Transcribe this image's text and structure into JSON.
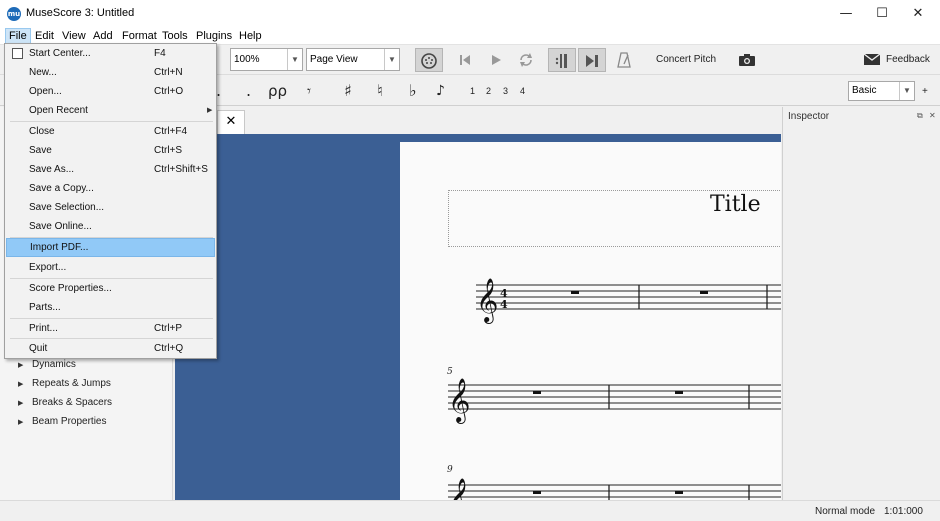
{
  "window": {
    "title": "MuseScore 3: Untitled",
    "app_icon": "mu",
    "minimize": "—",
    "maximize": "☐",
    "close": "✕"
  },
  "menubar": [
    "File",
    "Edit",
    "View",
    "Add",
    "Format",
    "Tools",
    "Plugins",
    "Help"
  ],
  "toolbar": {
    "zoom": "100%",
    "view_mode": "Page View",
    "concert_pitch": "Concert Pitch",
    "feedback": "Feedback",
    "workspace": "Basic",
    "workspace_add": "+",
    "voices": [
      "1",
      "2",
      "3",
      "4"
    ],
    "accidentals": [
      "♯",
      "♮",
      "♭"
    ]
  },
  "file_menu": {
    "start_center": {
      "label": "Start Center...",
      "shortcut": "F4"
    },
    "new": {
      "label": "New...",
      "shortcut": "Ctrl+N"
    },
    "open": {
      "label": "Open...",
      "shortcut": "Ctrl+O"
    },
    "open_recent": {
      "label": "Open Recent",
      "submenu_arrow": "▶"
    },
    "close": {
      "label": "Close",
      "shortcut": "Ctrl+F4"
    },
    "save": {
      "label": "Save",
      "shortcut": "Ctrl+S"
    },
    "save_as": {
      "label": "Save As...",
      "shortcut": "Ctrl+Shift+S"
    },
    "save_copy": {
      "label": "Save a Copy..."
    },
    "save_selection": {
      "label": "Save Selection..."
    },
    "save_online": {
      "label": "Save Online..."
    },
    "import_pdf": {
      "label": "Import PDF..."
    },
    "export": {
      "label": "Export..."
    },
    "score_properties": {
      "label": "Score Properties..."
    },
    "parts": {
      "label": "Parts..."
    },
    "print": {
      "label": "Print...",
      "shortcut": "Ctrl+P"
    },
    "quit": {
      "label": "Quit",
      "shortcut": "Ctrl+Q"
    }
  },
  "palettes": [
    "Dynamics",
    "Repeats & Jumps",
    "Breaks & Spacers",
    "Beam Properties"
  ],
  "score": {
    "title": "Title",
    "time_signature": {
      "numerator": "4",
      "denominator": "4"
    },
    "measure_numbers": [
      "5",
      "9"
    ],
    "tab_close": "✕"
  },
  "inspector": {
    "title": "Inspector"
  },
  "status": {
    "mode": "Normal mode",
    "time": "1:01:000"
  },
  "colors": {
    "canvas": "#3b5f94",
    "highlight": "#91c9f7",
    "menu_active": "#cde4f7"
  }
}
